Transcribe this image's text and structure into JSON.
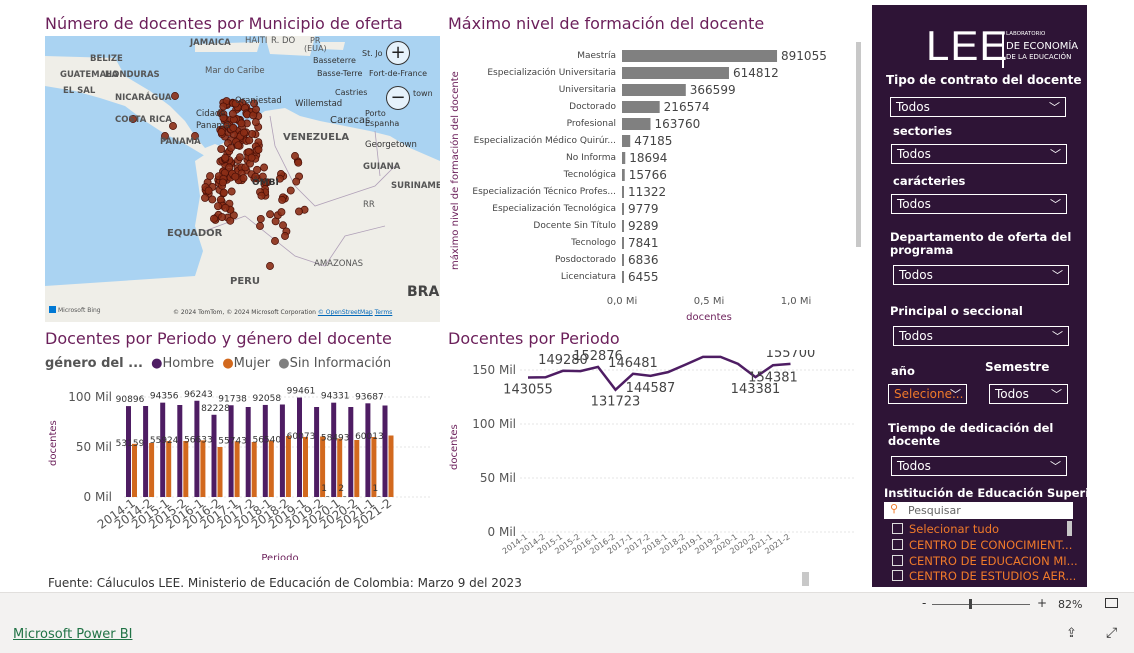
{
  "titles": {
    "map": "Número de docentes por Municipio de oferta",
    "formation": "Máximo nivel de formación del docente",
    "gender": "Docentes por Periodo y género del docente",
    "period": "Docentes por Periodo"
  },
  "map": {
    "labels": [
      "JAMAICA",
      "HAITÍ",
      "R. DO",
      "PR",
      "(EUA)",
      "BELIZE",
      "Mar do Caribe",
      "Basseterre",
      "St. Jo",
      "Basse-Terre",
      "Fort-de-France",
      "GUATEMALA",
      "HONDURAS",
      "EL SAL",
      "NICARÁGUA",
      "Castries",
      "town",
      "COSTA RICA",
      "Oranjestad",
      "Willemstad",
      "Cidade",
      "Panamá",
      "Porto",
      "Espanha",
      "Caracas",
      "PANAMA",
      "VENEZUELA",
      "Georgetown",
      "GUIANA",
      "ÔMBI",
      "SURINAME",
      "EQUADOR",
      "RR",
      "PERU",
      "AMAZONAS",
      "BRAS"
    ],
    "zoom_in": "+",
    "zoom_out": "−",
    "bing": "Microsoft Bing",
    "attribution": "© 2024 TomTom, © 2024 Microsoft Corporation",
    "osm": "© OpenStreetMap",
    "terms": "Terms"
  },
  "formation": {
    "ylabel": "máximo nivel de formación del docente",
    "xlabel": "docentes",
    "ticks": [
      "0,0 Mi",
      "0,5 Mi",
      "1,0 Mi"
    ]
  },
  "gender": {
    "legend_title": "género del ...",
    "legend": [
      "Hombre",
      "Mujer",
      "Sin Información"
    ],
    "ylabel": "docentes",
    "xlabel": "Periodo",
    "yticks": [
      "100 Mil",
      "50 Mil",
      "0 Mil"
    ]
  },
  "period": {
    "ylabel": "docentes",
    "yticks": [
      "150 Mil",
      "100 Mil",
      "50 Mil",
      "0 Mil"
    ]
  },
  "chart_data": [
    {
      "type": "bar",
      "title": "Máximo nivel de formación del docente",
      "ylabel": "máximo nivel de formación del docente",
      "xlabel": "docentes",
      "categories": [
        "Maestría",
        "Especialización Universitaria",
        "Universitaria",
        "Doctorado",
        "Profesional",
        "Especialización Médico Quirúr...",
        "No Informa",
        "Tecnológica",
        "Especialización Técnico Profes...",
        "Especialización Tecnológica",
        "Docente Sin Título",
        "Tecnologo",
        "Posdoctorado",
        "Licenciatura"
      ],
      "values": [
        891055,
        614812,
        366599,
        216574,
        163760,
        47185,
        18694,
        15766,
        11322,
        9779,
        9289,
        7841,
        6836,
        6455
      ],
      "labels": [
        "891055",
        "614812",
        "366599",
        "216574",
        "163760",
        "47185",
        "18694",
        "15766",
        "11322",
        "9779",
        "9289",
        "7841",
        "6836",
        "6455"
      ],
      "xlim": [
        0,
        1000000
      ]
    },
    {
      "type": "bar",
      "title": "Docentes por Periodo y género del docente",
      "xlabel": "Periodo",
      "ylabel": "docentes",
      "categories": [
        "2014-1",
        "2014-2",
        "2015-1",
        "2015-2",
        "2016-1",
        "2016-2",
        "2017-1",
        "2017-2",
        "2018-1",
        "2018-2",
        "2019-1",
        "2019-2",
        "2020-1",
        "2020-2",
        "2021-1",
        "2021-2"
      ],
      "series": [
        {
          "name": "Hombre",
          "values": [
            90896,
            91000,
            94356,
            92000,
            96243,
            82228,
            91738,
            90000,
            92058,
            92500,
            99461,
            90000,
            94331,
            90000,
            93687,
            91500
          ]
        },
        {
          "name": "Mujer",
          "values": [
            53159,
            54000,
            55924,
            56000,
            56633,
            50000,
            55743,
            55000,
            56540,
            61000,
            60073,
            60500,
            58493,
            57000,
            60013,
            61500
          ]
        },
        {
          "name": "Sin Información",
          "values": [
            0,
            0,
            0,
            0,
            0,
            0,
            0,
            0,
            0,
            0,
            0,
            1,
            2,
            0,
            1,
            0
          ]
        }
      ],
      "hombre_labels": [
        "90896",
        "",
        "94356",
        "",
        "96243",
        "82228",
        "91738",
        "",
        "92058",
        "",
        "99461",
        "",
        "94331",
        "",
        "93687",
        ""
      ],
      "mujer_labels": [
        "53159",
        "",
        "55924",
        "",
        "56633",
        "",
        "55743",
        "",
        "56540",
        "",
        "60073",
        "",
        "58493",
        "",
        "60013",
        ""
      ],
      "sin_labels": [
        "",
        "",
        "",
        "",
        "",
        "",
        "",
        "",
        "",
        "",
        "",
        "1",
        "2",
        "",
        "1",
        ""
      ],
      "ylim": [
        0,
        110000
      ],
      "colors": {
        "Hombre": "#4e1d63",
        "Mujer": "#d2691e",
        "Sin Información": "#7f7f7f"
      }
    },
    {
      "type": "line",
      "title": "Docentes por Periodo",
      "ylabel": "docentes",
      "x": [
        "2014-1",
        "2014-2",
        "2015-1",
        "2015-2",
        "2016-1",
        "2016-2",
        "2017-1",
        "2017-2",
        "2018-1",
        "2018-2",
        "2019-1",
        "2019-2",
        "2020-1",
        "2020-2",
        "2021-1",
        "2021-2"
      ],
      "values": [
        143055,
        143300,
        149280,
        149000,
        152876,
        131723,
        146481,
        144587,
        148000,
        155000,
        162135,
        162200,
        155700,
        143381,
        154381,
        155700
      ],
      "labels": [
        "143055",
        "",
        "149280",
        "",
        "152876",
        "131723",
        "146481",
        "144587",
        "",
        "",
        "162135",
        "",
        "",
        "143381",
        "154381",
        "155700"
      ],
      "ylim": [
        0,
        165000
      ]
    }
  ],
  "source": "Fuente: Cáluculos LEE. Ministerio de Educación de Colombia: Marzo 9 del 2023",
  "sidebar": {
    "logo_big": "LEE",
    "logo_l1": "LABORATORIO",
    "logo_l2": "DE ECONOMÍA",
    "logo_l3": "DE LA EDUCACIÓN",
    "tipo_label": "Tipo de contrato del docente",
    "tipo_value": "Todos",
    "sectorias_label": "sectories",
    "sectorias_value": "Todos",
    "caracteres_label": "carácteries",
    "caracteres_value": "Todos",
    "depto_label_1": "Departamento de oferta del",
    "depto_label_2": "programa",
    "depto_value": "Todos",
    "principal_label": "Principal o seccional",
    "principal_value": "Todos",
    "ano_label": "año",
    "ano_value": "Selecione...",
    "semestre_label": "Semestre",
    "semestre_value": "Todos",
    "tiempo_label_1": "Tiempo de dedicación del",
    "tiempo_label_2": "docente",
    "tiempo_value": "Todos",
    "inst_label": "Institución de Educación Superior",
    "search_placeholder": "Pesquisar",
    "options": [
      "Selecionar tudo",
      "CENTRO DE CONOCIMIENT...",
      "CENTRO DE EDUCACION MI...",
      "CENTRO DE ESTUDIOS AER..."
    ]
  },
  "footer": {
    "zoom_minus": "-",
    "zoom_plus": "+",
    "zoom_level": "82%",
    "powerbi_link": "Microsoft Power BI"
  }
}
